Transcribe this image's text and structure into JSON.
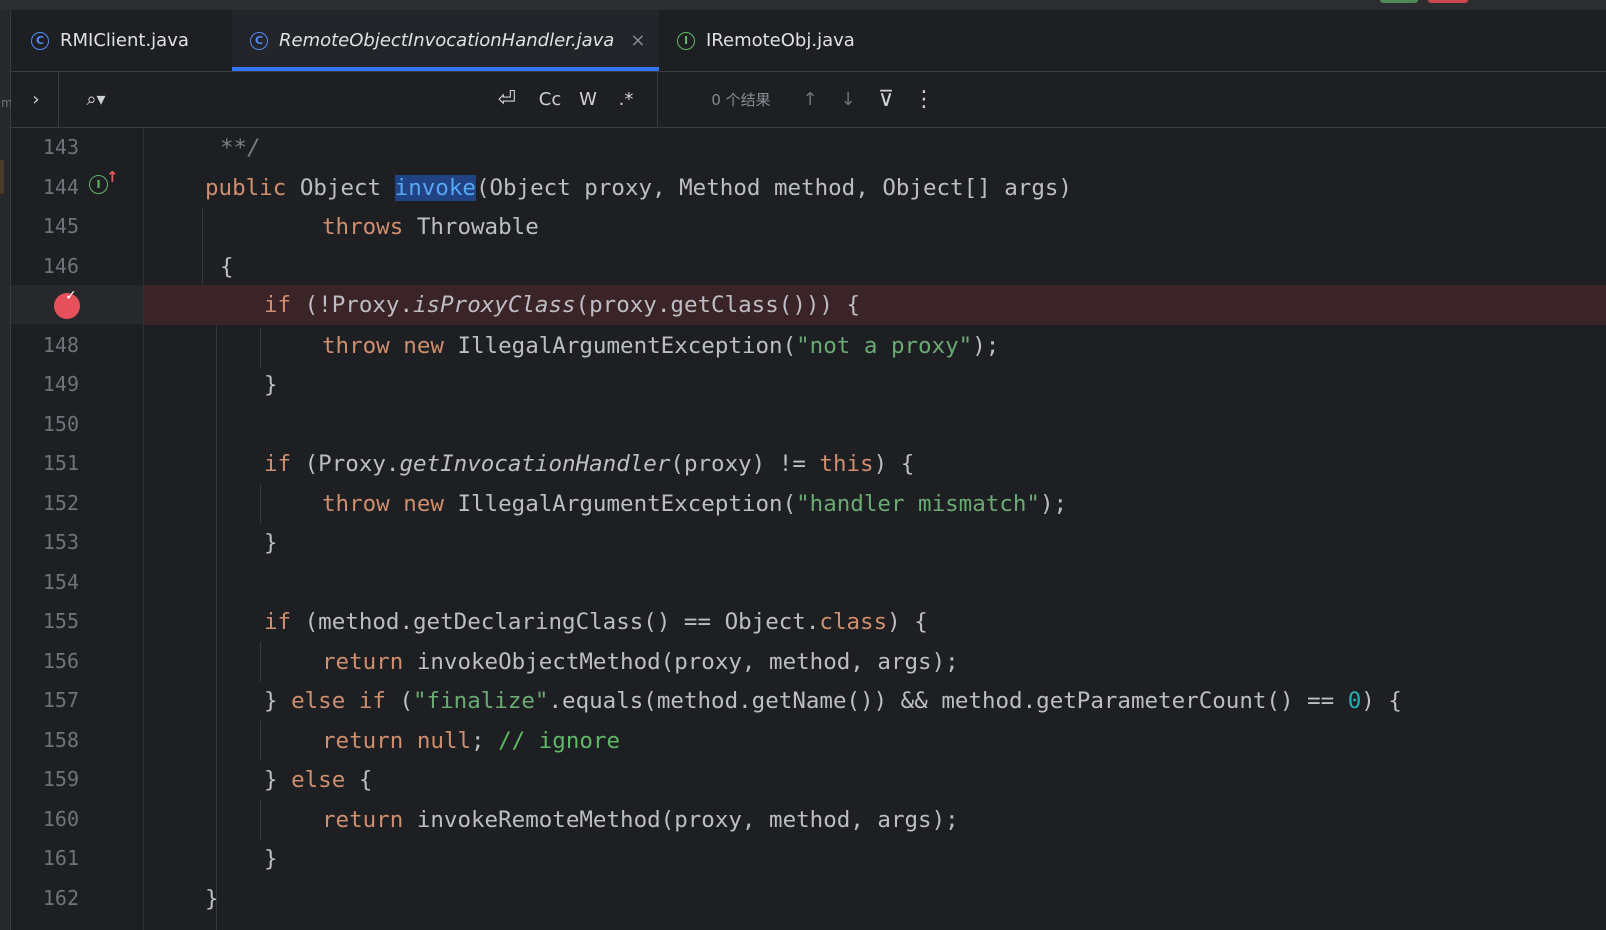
{
  "tabs": [
    {
      "label": "RMIClient.java",
      "icon": "class-icon",
      "active": false
    },
    {
      "label": "RemoteObjectInvocationHandler.java",
      "icon": "class-icon",
      "active": true
    },
    {
      "label": "IRemoteObj.java",
      "icon": "interface-icon",
      "active": false
    }
  ],
  "tab_icon_letters": {
    "class": "C",
    "interface": "I"
  },
  "findbar": {
    "expand": "›",
    "search_icon": "⌕▾",
    "wrap": "⏎",
    "match_case": "Cc",
    "whole_words": "W",
    "regex": ".*",
    "results": "0 个结果",
    "up": "↑",
    "down": "↓",
    "filter": "⊽",
    "more": "⋮"
  },
  "colors": {
    "keyword": "#cf8e6d",
    "string": "#6aab73",
    "number": "#2aacb8",
    "accent": "#3574f0",
    "breakpoint": "#e5505b"
  },
  "gutter": {
    "line_numbers": [
      "143",
      "144",
      "145",
      "146",
      "",
      "148",
      "149",
      "150",
      "151",
      "152",
      "153",
      "154",
      "155",
      "156",
      "157",
      "158",
      "159",
      "160",
      "161",
      "162"
    ],
    "breakpoint_line": "147",
    "impl_marker_line": "144"
  },
  "code": {
    "l143": "**/",
    "l144": {
      "kw": "public",
      "type": "Object",
      "name": "invoke",
      "rest": "(Object proxy, Method method, Object[] args)"
    },
    "l145": {
      "kw": "throws",
      "rest": "Throwable"
    },
    "l146": "{",
    "l147": {
      "kw": "if",
      "a": "(!Proxy.",
      "m": "isProxyClass",
      "b": "(proxy.getClass())) {"
    },
    "l148": {
      "kw1": "throw",
      "kw2": "new",
      "a": "IllegalArgumentException(",
      "s": "\"not a proxy\"",
      "b": ");"
    },
    "l149": "}",
    "l151": {
      "kw": "if",
      "a": "(Proxy.",
      "m": "getInvocationHandler",
      "b": "(proxy) != ",
      "kw2": "this",
      "c": ") {"
    },
    "l152": {
      "kw1": "throw",
      "kw2": "new",
      "a": "IllegalArgumentException(",
      "s": "\"handler mismatch\"",
      "b": ");"
    },
    "l153": "}",
    "l155": {
      "kw": "if",
      "a": "(method.getDeclaringClass() == Object.",
      "kw2": "class",
      "b": ") {"
    },
    "l156": {
      "kw": "return",
      "a": "invokeObjectMethod(proxy, method, args);"
    },
    "l157": {
      "a": "} ",
      "kw1": "else",
      "kw2": "if",
      "b": "(",
      "s": "\"finalize\"",
      "c": ".equals(method.getName()) && method.getParameterCount() == ",
      "n": "0",
      "d": ") {"
    },
    "l158": {
      "kw": "return",
      "kw2": "null",
      "a": ";",
      "cm": "// ignore"
    },
    "l159": {
      "a": "} ",
      "kw": "else",
      "b": " {"
    },
    "l160": {
      "kw": "return",
      "a": "invokeRemoteMethod(proxy, method, args);"
    },
    "l161": "}",
    "l162": "}"
  }
}
